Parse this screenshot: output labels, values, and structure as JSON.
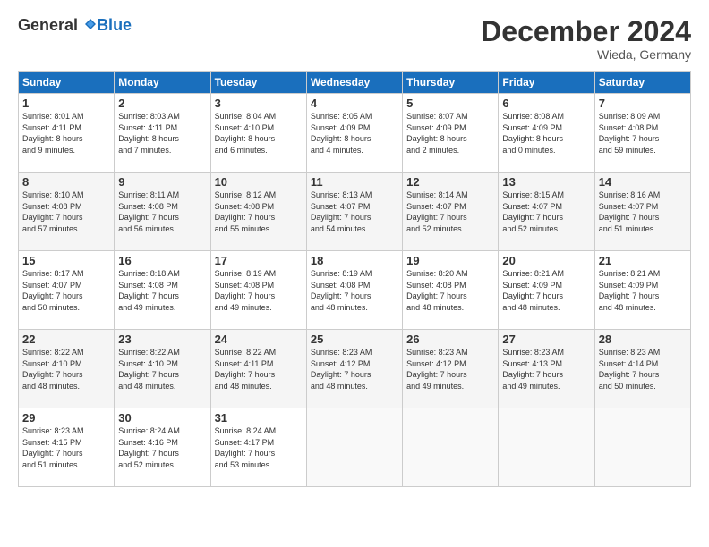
{
  "header": {
    "logo_general": "General",
    "logo_blue": "Blue",
    "month": "December 2024",
    "location": "Wieda, Germany"
  },
  "days": [
    "Sunday",
    "Monday",
    "Tuesday",
    "Wednesday",
    "Thursday",
    "Friday",
    "Saturday"
  ],
  "weeks": [
    [
      {
        "day": "1",
        "text": "Sunrise: 8:01 AM\nSunset: 4:11 PM\nDaylight: 8 hours\nand 9 minutes."
      },
      {
        "day": "2",
        "text": "Sunrise: 8:03 AM\nSunset: 4:11 PM\nDaylight: 8 hours\nand 7 minutes."
      },
      {
        "day": "3",
        "text": "Sunrise: 8:04 AM\nSunset: 4:10 PM\nDaylight: 8 hours\nand 6 minutes."
      },
      {
        "day": "4",
        "text": "Sunrise: 8:05 AM\nSunset: 4:09 PM\nDaylight: 8 hours\nand 4 minutes."
      },
      {
        "day": "5",
        "text": "Sunrise: 8:07 AM\nSunset: 4:09 PM\nDaylight: 8 hours\nand 2 minutes."
      },
      {
        "day": "6",
        "text": "Sunrise: 8:08 AM\nSunset: 4:09 PM\nDaylight: 8 hours\nand 0 minutes."
      },
      {
        "day": "7",
        "text": "Sunrise: 8:09 AM\nSunset: 4:08 PM\nDaylight: 7 hours\nand 59 minutes."
      }
    ],
    [
      {
        "day": "8",
        "text": "Sunrise: 8:10 AM\nSunset: 4:08 PM\nDaylight: 7 hours\nand 57 minutes."
      },
      {
        "day": "9",
        "text": "Sunrise: 8:11 AM\nSunset: 4:08 PM\nDaylight: 7 hours\nand 56 minutes."
      },
      {
        "day": "10",
        "text": "Sunrise: 8:12 AM\nSunset: 4:08 PM\nDaylight: 7 hours\nand 55 minutes."
      },
      {
        "day": "11",
        "text": "Sunrise: 8:13 AM\nSunset: 4:07 PM\nDaylight: 7 hours\nand 54 minutes."
      },
      {
        "day": "12",
        "text": "Sunrise: 8:14 AM\nSunset: 4:07 PM\nDaylight: 7 hours\nand 52 minutes."
      },
      {
        "day": "13",
        "text": "Sunrise: 8:15 AM\nSunset: 4:07 PM\nDaylight: 7 hours\nand 52 minutes."
      },
      {
        "day": "14",
        "text": "Sunrise: 8:16 AM\nSunset: 4:07 PM\nDaylight: 7 hours\nand 51 minutes."
      }
    ],
    [
      {
        "day": "15",
        "text": "Sunrise: 8:17 AM\nSunset: 4:07 PM\nDaylight: 7 hours\nand 50 minutes."
      },
      {
        "day": "16",
        "text": "Sunrise: 8:18 AM\nSunset: 4:08 PM\nDaylight: 7 hours\nand 49 minutes."
      },
      {
        "day": "17",
        "text": "Sunrise: 8:19 AM\nSunset: 4:08 PM\nDaylight: 7 hours\nand 49 minutes."
      },
      {
        "day": "18",
        "text": "Sunrise: 8:19 AM\nSunset: 4:08 PM\nDaylight: 7 hours\nand 48 minutes."
      },
      {
        "day": "19",
        "text": "Sunrise: 8:20 AM\nSunset: 4:08 PM\nDaylight: 7 hours\nand 48 minutes."
      },
      {
        "day": "20",
        "text": "Sunrise: 8:21 AM\nSunset: 4:09 PM\nDaylight: 7 hours\nand 48 minutes."
      },
      {
        "day": "21",
        "text": "Sunrise: 8:21 AM\nSunset: 4:09 PM\nDaylight: 7 hours\nand 48 minutes."
      }
    ],
    [
      {
        "day": "22",
        "text": "Sunrise: 8:22 AM\nSunset: 4:10 PM\nDaylight: 7 hours\nand 48 minutes."
      },
      {
        "day": "23",
        "text": "Sunrise: 8:22 AM\nSunset: 4:10 PM\nDaylight: 7 hours\nand 48 minutes."
      },
      {
        "day": "24",
        "text": "Sunrise: 8:22 AM\nSunset: 4:11 PM\nDaylight: 7 hours\nand 48 minutes."
      },
      {
        "day": "25",
        "text": "Sunrise: 8:23 AM\nSunset: 4:12 PM\nDaylight: 7 hours\nand 48 minutes."
      },
      {
        "day": "26",
        "text": "Sunrise: 8:23 AM\nSunset: 4:12 PM\nDaylight: 7 hours\nand 49 minutes."
      },
      {
        "day": "27",
        "text": "Sunrise: 8:23 AM\nSunset: 4:13 PM\nDaylight: 7 hours\nand 49 minutes."
      },
      {
        "day": "28",
        "text": "Sunrise: 8:23 AM\nSunset: 4:14 PM\nDaylight: 7 hours\nand 50 minutes."
      }
    ],
    [
      {
        "day": "29",
        "text": "Sunrise: 8:23 AM\nSunset: 4:15 PM\nDaylight: 7 hours\nand 51 minutes."
      },
      {
        "day": "30",
        "text": "Sunrise: 8:24 AM\nSunset: 4:16 PM\nDaylight: 7 hours\nand 52 minutes."
      },
      {
        "day": "31",
        "text": "Sunrise: 8:24 AM\nSunset: 4:17 PM\nDaylight: 7 hours\nand 53 minutes."
      },
      {
        "day": "",
        "text": ""
      },
      {
        "day": "",
        "text": ""
      },
      {
        "day": "",
        "text": ""
      },
      {
        "day": "",
        "text": ""
      }
    ]
  ]
}
